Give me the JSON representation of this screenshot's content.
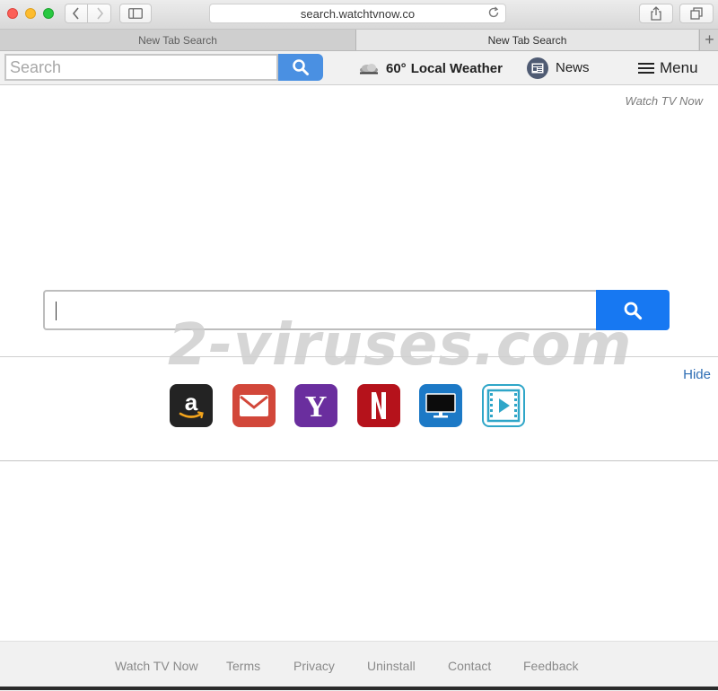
{
  "browser": {
    "url": "search.watchtvnow.co",
    "tabs": [
      {
        "label": "New Tab Search",
        "active": false
      },
      {
        "label": "New Tab Search",
        "active": true
      }
    ]
  },
  "toolbar": {
    "search_placeholder": "Search",
    "weather_temp": "60°",
    "weather_label": "Local Weather",
    "news_label": "News",
    "menu_label": "Menu"
  },
  "page": {
    "brand": "Watch TV Now",
    "watermark": "2-viruses.com",
    "hide_label": "Hide",
    "search_value": "",
    "quick_links": [
      {
        "name": "amazon",
        "icon": "amazon-icon"
      },
      {
        "name": "mail",
        "icon": "mail-icon"
      },
      {
        "name": "yahoo",
        "icon": "yahoo-icon"
      },
      {
        "name": "netflix",
        "icon": "netflix-icon"
      },
      {
        "name": "tv",
        "icon": "tv-icon"
      },
      {
        "name": "video",
        "icon": "video-icon"
      }
    ]
  },
  "footer": {
    "links": [
      "Watch TV Now",
      "Terms",
      "Privacy",
      "Uninstall",
      "Contact",
      "Feedback"
    ]
  },
  "colors": {
    "search_button": "#1778f2",
    "toolbar_search_button": "#4a90e2",
    "link": "#2e6db4"
  }
}
